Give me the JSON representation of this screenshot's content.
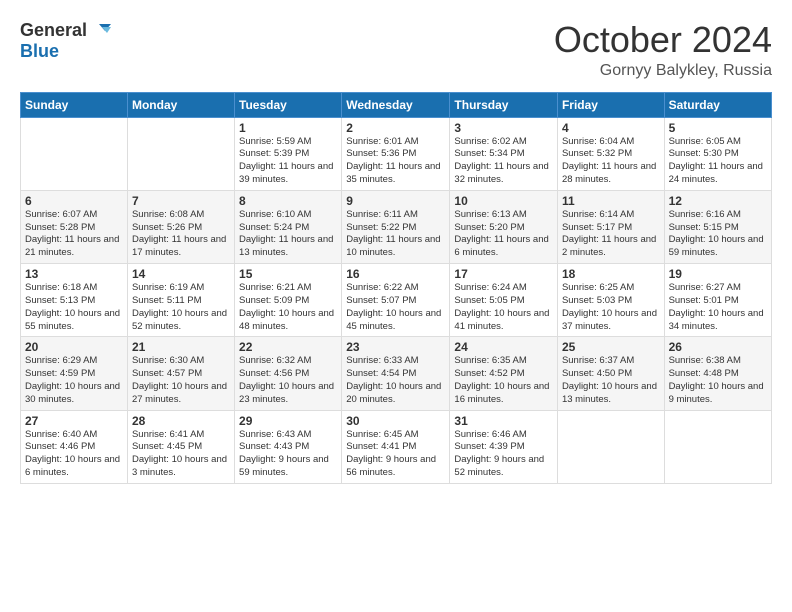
{
  "header": {
    "logo_line1": "General",
    "logo_line2": "Blue",
    "month": "October 2024",
    "location": "Gornyy Balykley, Russia"
  },
  "weekdays": [
    "Sunday",
    "Monday",
    "Tuesday",
    "Wednesday",
    "Thursday",
    "Friday",
    "Saturday"
  ],
  "weeks": [
    [
      {
        "day": "",
        "info": ""
      },
      {
        "day": "",
        "info": ""
      },
      {
        "day": "1",
        "info": "Sunrise: 5:59 AM\nSunset: 5:39 PM\nDaylight: 11 hours and 39 minutes."
      },
      {
        "day": "2",
        "info": "Sunrise: 6:01 AM\nSunset: 5:36 PM\nDaylight: 11 hours and 35 minutes."
      },
      {
        "day": "3",
        "info": "Sunrise: 6:02 AM\nSunset: 5:34 PM\nDaylight: 11 hours and 32 minutes."
      },
      {
        "day": "4",
        "info": "Sunrise: 6:04 AM\nSunset: 5:32 PM\nDaylight: 11 hours and 28 minutes."
      },
      {
        "day": "5",
        "info": "Sunrise: 6:05 AM\nSunset: 5:30 PM\nDaylight: 11 hours and 24 minutes."
      }
    ],
    [
      {
        "day": "6",
        "info": "Sunrise: 6:07 AM\nSunset: 5:28 PM\nDaylight: 11 hours and 21 minutes."
      },
      {
        "day": "7",
        "info": "Sunrise: 6:08 AM\nSunset: 5:26 PM\nDaylight: 11 hours and 17 minutes."
      },
      {
        "day": "8",
        "info": "Sunrise: 6:10 AM\nSunset: 5:24 PM\nDaylight: 11 hours and 13 minutes."
      },
      {
        "day": "9",
        "info": "Sunrise: 6:11 AM\nSunset: 5:22 PM\nDaylight: 11 hours and 10 minutes."
      },
      {
        "day": "10",
        "info": "Sunrise: 6:13 AM\nSunset: 5:20 PM\nDaylight: 11 hours and 6 minutes."
      },
      {
        "day": "11",
        "info": "Sunrise: 6:14 AM\nSunset: 5:17 PM\nDaylight: 11 hours and 2 minutes."
      },
      {
        "day": "12",
        "info": "Sunrise: 6:16 AM\nSunset: 5:15 PM\nDaylight: 10 hours and 59 minutes."
      }
    ],
    [
      {
        "day": "13",
        "info": "Sunrise: 6:18 AM\nSunset: 5:13 PM\nDaylight: 10 hours and 55 minutes."
      },
      {
        "day": "14",
        "info": "Sunrise: 6:19 AM\nSunset: 5:11 PM\nDaylight: 10 hours and 52 minutes."
      },
      {
        "day": "15",
        "info": "Sunrise: 6:21 AM\nSunset: 5:09 PM\nDaylight: 10 hours and 48 minutes."
      },
      {
        "day": "16",
        "info": "Sunrise: 6:22 AM\nSunset: 5:07 PM\nDaylight: 10 hours and 45 minutes."
      },
      {
        "day": "17",
        "info": "Sunrise: 6:24 AM\nSunset: 5:05 PM\nDaylight: 10 hours and 41 minutes."
      },
      {
        "day": "18",
        "info": "Sunrise: 6:25 AM\nSunset: 5:03 PM\nDaylight: 10 hours and 37 minutes."
      },
      {
        "day": "19",
        "info": "Sunrise: 6:27 AM\nSunset: 5:01 PM\nDaylight: 10 hours and 34 minutes."
      }
    ],
    [
      {
        "day": "20",
        "info": "Sunrise: 6:29 AM\nSunset: 4:59 PM\nDaylight: 10 hours and 30 minutes."
      },
      {
        "day": "21",
        "info": "Sunrise: 6:30 AM\nSunset: 4:57 PM\nDaylight: 10 hours and 27 minutes."
      },
      {
        "day": "22",
        "info": "Sunrise: 6:32 AM\nSunset: 4:56 PM\nDaylight: 10 hours and 23 minutes."
      },
      {
        "day": "23",
        "info": "Sunrise: 6:33 AM\nSunset: 4:54 PM\nDaylight: 10 hours and 20 minutes."
      },
      {
        "day": "24",
        "info": "Sunrise: 6:35 AM\nSunset: 4:52 PM\nDaylight: 10 hours and 16 minutes."
      },
      {
        "day": "25",
        "info": "Sunrise: 6:37 AM\nSunset: 4:50 PM\nDaylight: 10 hours and 13 minutes."
      },
      {
        "day": "26",
        "info": "Sunrise: 6:38 AM\nSunset: 4:48 PM\nDaylight: 10 hours and 9 minutes."
      }
    ],
    [
      {
        "day": "27",
        "info": "Sunrise: 6:40 AM\nSunset: 4:46 PM\nDaylight: 10 hours and 6 minutes."
      },
      {
        "day": "28",
        "info": "Sunrise: 6:41 AM\nSunset: 4:45 PM\nDaylight: 10 hours and 3 minutes."
      },
      {
        "day": "29",
        "info": "Sunrise: 6:43 AM\nSunset: 4:43 PM\nDaylight: 9 hours and 59 minutes."
      },
      {
        "day": "30",
        "info": "Sunrise: 6:45 AM\nSunset: 4:41 PM\nDaylight: 9 hours and 56 minutes."
      },
      {
        "day": "31",
        "info": "Sunrise: 6:46 AM\nSunset: 4:39 PM\nDaylight: 9 hours and 52 minutes."
      },
      {
        "day": "",
        "info": ""
      },
      {
        "day": "",
        "info": ""
      }
    ]
  ]
}
